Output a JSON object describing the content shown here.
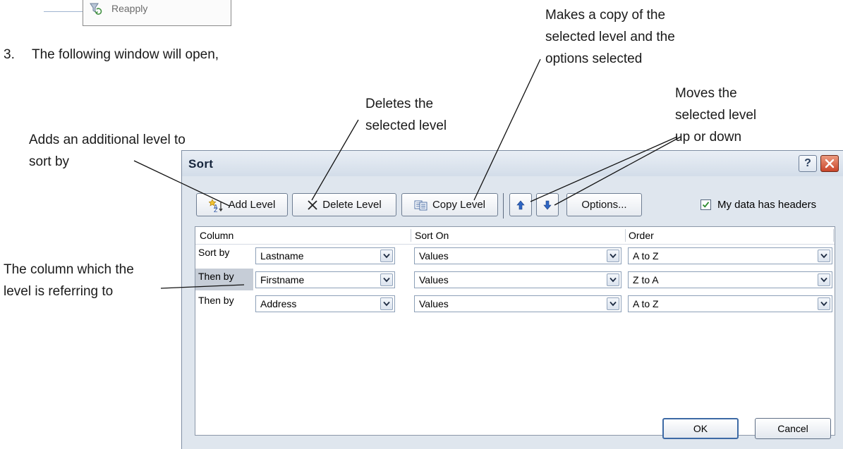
{
  "top_fragment": {
    "label": "Reapply"
  },
  "step": {
    "number": "3.",
    "text": "The following window will open,"
  },
  "annotations": {
    "add_level": [
      "Adds an additional level to",
      "sort by"
    ],
    "delete_level": [
      "Deletes the",
      "selected level"
    ],
    "copy_level": [
      "Makes a copy of the",
      "selected level and the",
      "options selected"
    ],
    "move_level": [
      "Moves the",
      "selected level",
      "up or down"
    ],
    "column": [
      "The column which the",
      "level is referring to"
    ]
  },
  "dialog": {
    "title": "Sort",
    "help_label": "?",
    "toolbar": {
      "add_level": "Add Level",
      "delete_level": "Delete Level",
      "copy_level": "Copy Level",
      "options": "Options...",
      "headers_label": "My data has headers",
      "headers_checked": true
    },
    "columns": {
      "column": "Column",
      "sort_on": "Sort On",
      "order": "Order"
    },
    "rows": [
      {
        "label": "Sort by",
        "column": "Lastname",
        "sort_on": "Values",
        "order": "A to Z"
      },
      {
        "label": "Then by",
        "column": "Firstname",
        "sort_on": "Values",
        "order": "Z to A"
      },
      {
        "label": "Then by",
        "column": "Address",
        "sort_on": "Values",
        "order": "A to Z"
      }
    ],
    "ok": "OK",
    "cancel": "Cancel"
  }
}
